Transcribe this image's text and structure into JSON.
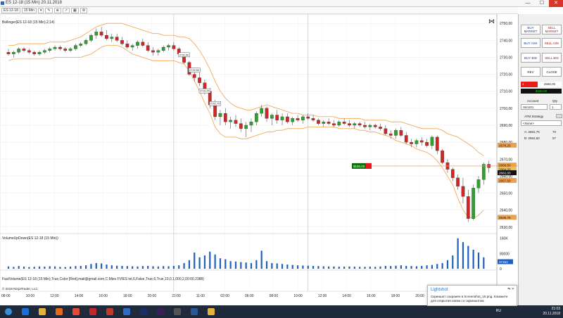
{
  "window": {
    "title": "ES 12-18 (15 Min)  20.11.2018",
    "controls": [
      "—",
      "☐",
      "✕"
    ]
  },
  "toolbar": {
    "instrument": "ES 12-18",
    "interval": "15 Min"
  },
  "chart": {
    "bollinger_label": "Bollinger(ES 12-18 (15 Min),2,14)",
    "volume_label": "VolumeUpDown(ES 12-18 (15 Min))",
    "fastvol_label": "FastVolume(ES 12-18 (15 Min),True,Color [Red],mail@gmail.com,C:Mies FVIES txt,6,False,True,6,True,10,0,1,000,2,00:00,2388)",
    "copyright": "© 2018 NinjaTrader, LLC",
    "price_ticks": [
      "2750,00",
      "2740,00",
      "2730,00",
      "2720,00",
      "2710,00",
      "2700,00",
      "2690,00",
      "2680,00",
      "2670,00",
      "2660,00",
      "2650,00",
      "2640,00",
      "2630,00"
    ],
    "volume_ticks": [
      "160K",
      "80000",
      "0"
    ],
    "time_ticks": [
      "08:00",
      "10:00",
      "12:00",
      "14:00",
      "16:00",
      "18:00",
      "20:00",
      "22:00",
      "11:00",
      "02:00",
      "06:00",
      "08:00",
      "10:00",
      "12:00",
      "14:00",
      "16:00",
      "18:00",
      "20:00"
    ],
    "price_markers": [
      "2678,25",
      "2666,50",
      "2664,00",
      "2662,00",
      "2657,50",
      "2635,75"
    ],
    "volume_marker": "37462",
    "pnl_flag": "$150,00",
    "bar_labels": [
      "2731,50",
      "2722,50",
      "2710,25",
      "2702,75"
    ],
    "candle_colors": {
      "up": "#2fa12f",
      "down": "#d12626",
      "band": "#f0a04a"
    }
  },
  "chart_data": {
    "type": "candlestick",
    "ylim": [
      2627,
      2753
    ],
    "candles": [
      [
        2733,
        2735,
        2731,
        2732
      ],
      [
        2732,
        2734,
        2730,
        2733
      ],
      [
        2733,
        2736,
        2732,
        2735
      ],
      [
        2735,
        2736,
        2733,
        2734
      ],
      [
        2734,
        2735,
        2732,
        2733
      ],
      [
        2733,
        2734,
        2731,
        2732
      ],
      [
        2732,
        2734,
        2731,
        2733
      ],
      [
        2733,
        2735,
        2732,
        2734
      ],
      [
        2734,
        2736,
        2733,
        2735
      ],
      [
        2735,
        2737,
        2734,
        2736
      ],
      [
        2736,
        2737,
        2734,
        2735
      ],
      [
        2735,
        2736,
        2733,
        2734
      ],
      [
        2734,
        2736,
        2733,
        2735
      ],
      [
        2735,
        2738,
        2734,
        2737
      ],
      [
        2737,
        2739,
        2736,
        2738
      ],
      [
        2738,
        2741,
        2737,
        2740
      ],
      [
        2740,
        2744,
        2739,
        2743
      ],
      [
        2743,
        2747,
        2741,
        2745
      ],
      [
        2745,
        2748,
        2742,
        2743
      ],
      [
        2743,
        2746,
        2740,
        2741
      ],
      [
        2741,
        2744,
        2739,
        2742
      ],
      [
        2742,
        2744,
        2739,
        2740
      ],
      [
        2740,
        2742,
        2737,
        2738
      ],
      [
        2738,
        2740,
        2735,
        2736
      ],
      [
        2736,
        2738,
        2734,
        2737
      ],
      [
        2737,
        2740,
        2735,
        2739
      ],
      [
        2739,
        2741,
        2736,
        2737
      ],
      [
        2737,
        2739,
        2733,
        2734
      ],
      [
        2734,
        2736,
        2731,
        2733
      ],
      [
        2733,
        2735,
        2731,
        2734
      ],
      [
        2734,
        2737,
        2733,
        2736
      ],
      [
        2736,
        2738,
        2734,
        2737
      ],
      [
        2737,
        2739,
        2734,
        2735
      ],
      [
        2735,
        2736,
        2731,
        2732
      ],
      [
        2732,
        2733,
        2726,
        2727
      ],
      [
        2727,
        2728,
        2719,
        2720
      ],
      [
        2720,
        2723,
        2716,
        2718
      ],
      [
        2718,
        2721,
        2713,
        2715
      ],
      [
        2715,
        2717,
        2708,
        2710
      ],
      [
        2710,
        2712,
        2700,
        2702
      ],
      [
        2702,
        2705,
        2693,
        2695
      ],
      [
        2695,
        2699,
        2690,
        2697
      ],
      [
        2697,
        2700,
        2690,
        2692
      ],
      [
        2692,
        2695,
        2688,
        2693
      ],
      [
        2693,
        2696,
        2689,
        2691
      ],
      [
        2691,
        2694,
        2686,
        2688
      ],
      [
        2688,
        2692,
        2683,
        2690
      ],
      [
        2690,
        2694,
        2686,
        2692
      ],
      [
        2692,
        2698,
        2690,
        2697
      ],
      [
        2697,
        2702,
        2695,
        2700
      ],
      [
        2700,
        2701,
        2692,
        2694
      ],
      [
        2694,
        2697,
        2690,
        2696
      ],
      [
        2696,
        2699,
        2691,
        2693
      ],
      [
        2693,
        2697,
        2690,
        2695
      ],
      [
        2695,
        2697,
        2691,
        2692
      ],
      [
        2692,
        2695,
        2690,
        2694
      ],
      [
        2694,
        2696,
        2692,
        2693
      ],
      [
        2693,
        2696,
        2691,
        2695
      ],
      [
        2695,
        2697,
        2693,
        2694
      ],
      [
        2694,
        2696,
        2692,
        2693
      ],
      [
        2693,
        2694,
        2690,
        2691
      ],
      [
        2691,
        2693,
        2689,
        2692
      ],
      [
        2692,
        2694,
        2690,
        2691
      ],
      [
        2691,
        2693,
        2689,
        2690
      ],
      [
        2690,
        2693,
        2689,
        2692
      ],
      [
        2692,
        2694,
        2690,
        2691
      ],
      [
        2691,
        2693,
        2689,
        2690
      ],
      [
        2690,
        2692,
        2688,
        2691
      ],
      [
        2691,
        2692,
        2689,
        2690
      ],
      [
        2690,
        2692,
        2688,
        2689
      ],
      [
        2689,
        2691,
        2687,
        2690
      ],
      [
        2690,
        2691,
        2688,
        2689
      ],
      [
        2689,
        2691,
        2687,
        2688
      ],
      [
        2688,
        2690,
        2684,
        2685
      ],
      [
        2685,
        2687,
        2682,
        2684
      ],
      [
        2684,
        2688,
        2682,
        2687
      ],
      [
        2687,
        2689,
        2683,
        2684
      ],
      [
        2684,
        2686,
        2679,
        2680
      ],
      [
        2680,
        2682,
        2677,
        2679
      ],
      [
        2679,
        2682,
        2677,
        2681
      ],
      [
        2681,
        2683,
        2678,
        2680
      ],
      [
        2680,
        2682,
        2677,
        2678
      ],
      [
        2678,
        2684,
        2676,
        2683
      ],
      [
        2683,
        2684,
        2673,
        2675
      ],
      [
        2675,
        2676,
        2667,
        2668
      ],
      [
        2668,
        2670,
        2662,
        2664
      ],
      [
        2664,
        2665,
        2657,
        2659
      ],
      [
        2659,
        2661,
        2652,
        2654
      ],
      [
        2654,
        2659,
        2644,
        2648
      ],
      [
        2648,
        2652,
        2633,
        2635
      ],
      [
        2635,
        2655,
        2634,
        2653
      ],
      [
        2653,
        2660,
        2650,
        2658
      ],
      [
        2658,
        2668,
        2655,
        2667
      ],
      [
        2667,
        2669,
        2662,
        2665
      ]
    ],
    "band_upper": [
      2737,
      2737,
      2738,
      2738,
      2738,
      2738,
      2738,
      2738,
      2739,
      2739,
      2739,
      2739,
      2740,
      2741,
      2742,
      2744,
      2746,
      2748,
      2749,
      2750,
      2750,
      2750,
      2750,
      2749,
      2748,
      2747,
      2746,
      2745,
      2744,
      2744,
      2743,
      2743,
      2743,
      2742,
      2742,
      2741,
      2738,
      2734,
      2729,
      2723,
      2716,
      2710,
      2706,
      2703,
      2701,
      2700,
      2699,
      2699,
      2700,
      2701,
      2702,
      2701,
      2700,
      2699,
      2698,
      2697,
      2697,
      2696,
      2696,
      2696,
      2695,
      2695,
      2695,
      2695,
      2694,
      2694,
      2694,
      2694,
      2694,
      2693,
      2693,
      2693,
      2693,
      2693,
      2692,
      2692,
      2692,
      2691,
      2690,
      2689,
      2688,
      2688,
      2688,
      2688,
      2687,
      2685,
      2684,
      2683,
      2681,
      2679,
      2677,
      2674,
      2672
    ],
    "band_lower": [
      2728,
      2729,
      2729,
      2729,
      2729,
      2729,
      2729,
      2729,
      2729,
      2730,
      2730,
      2730,
      2730,
      2730,
      2730,
      2731,
      2732,
      2734,
      2736,
      2737,
      2737,
      2737,
      2736,
      2734,
      2732,
      2731,
      2730,
      2729,
      2728,
      2728,
      2728,
      2728,
      2728,
      2727,
      2726,
      2722,
      2716,
      2710,
      2703,
      2697,
      2689,
      2685,
      2683,
      2683,
      2683,
      2682,
      2682,
      2683,
      2684,
      2685,
      2686,
      2686,
      2687,
      2687,
      2688,
      2688,
      2688,
      2688,
      2689,
      2689,
      2689,
      2689,
      2689,
      2689,
      2688,
      2688,
      2688,
      2688,
      2687,
      2687,
      2686,
      2686,
      2685,
      2684,
      2683,
      2681,
      2680,
      2679,
      2678,
      2676,
      2675,
      2674,
      2672,
      2669,
      2665,
      2660,
      2655,
      2647,
      2640,
      2636,
      2635,
      2637,
      2640
    ],
    "volumes": [
      12,
      10,
      14,
      11,
      9,
      10,
      12,
      11,
      13,
      12,
      10,
      9,
      11,
      14,
      15,
      18,
      25,
      30,
      28,
      22,
      18,
      16,
      15,
      14,
      13,
      12,
      14,
      15,
      13,
      12,
      14,
      13,
      15,
      18,
      30,
      45,
      85,
      60,
      70,
      90,
      75,
      55,
      50,
      40,
      38,
      35,
      33,
      30,
      45,
      95,
      40,
      30,
      28,
      25,
      22,
      20,
      18,
      17,
      16,
      15,
      14,
      13,
      12,
      12,
      11,
      11,
      12,
      11,
      10,
      10,
      11,
      10,
      12,
      15,
      14,
      16,
      18,
      15,
      14,
      13,
      15,
      18,
      20,
      25,
      30,
      45,
      70,
      160,
      140,
      120,
      100,
      85,
      60
    ]
  },
  "dom": {
    "buttons": [
      "BUY MARKET",
      "SELL MARKET",
      "BUY ASK",
      "SELL ASK",
      "BUY BID",
      "SELL BID",
      "REV",
      "CLOSE"
    ],
    "qty": "1",
    "price": "2666,00",
    "pnl": "$150,00",
    "account_label": "Account",
    "qty_label": "Qty",
    "account": "Sim101",
    "qty_value": "1",
    "atm_label": "ATM Strategy",
    "atm_value": "<None>",
    "ask": "A: 2662,75",
    "ask_size": "70",
    "bid": "B: 2662,50",
    "bid_size": "57"
  },
  "toast": {
    "title": "Lightshot",
    "message": "Скриншот сохранён в Screenshot_10.png. Кликните для открытия папки со скриншотом."
  },
  "tray": {
    "lang": "RU",
    "time": "21:03",
    "date": "20.11.2018"
  },
  "taskbar": {
    "apps": [
      "start",
      "ie",
      "explorer",
      "firefox",
      "chrome",
      "opera",
      "filezilla",
      "ninjatrader",
      "photoshop",
      "animate",
      "app",
      "word",
      "folder"
    ],
    "colors": [
      "#3a8fd8",
      "#1d6fd6",
      "#e8b33c",
      "#e36a1c",
      "#e84a3a",
      "#c4262b",
      "#c0392b",
      "#2e6cc7",
      "#1a2e63",
      "#3b1e55",
      "#555",
      "#2b5797",
      "#e8b33c"
    ]
  }
}
